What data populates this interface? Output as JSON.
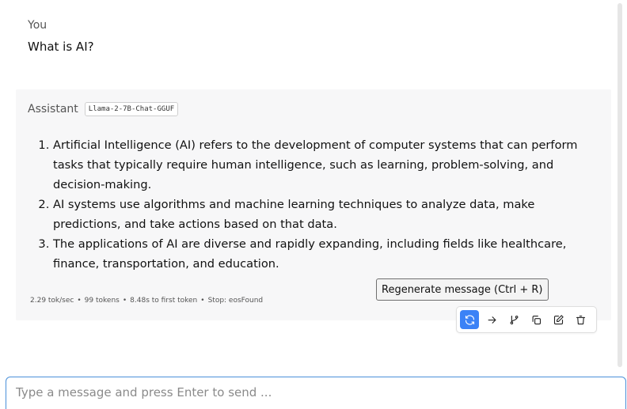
{
  "user_message": {
    "role_label": "You",
    "text": "What is AI?"
  },
  "assistant_message": {
    "role_label": "Assistant",
    "model": "Llama-2-7B-Chat-GGUF",
    "items": [
      "Artificial Intelligence (AI) refers to the development of computer systems that can perform tasks that typically require human intelligence, such as learning, problem-solving, and decision-making.",
      "AI systems use algorithms and machine learning techniques to analyze data, make predictions, and take actions based on that data.",
      "The applications of AI are diverse and rapidly expanding, including fields like healthcare, finance, transportation, and education."
    ],
    "stats": {
      "speed": "2.29 tok/sec",
      "tokens": "99 tokens",
      "first_token": "8.48s to first token",
      "stop": "Stop: eosFound",
      "separator": "•"
    }
  },
  "tooltip": {
    "text": "Regenerate message (Ctrl + R)"
  },
  "actions": [
    {
      "name": "regenerate",
      "icon": "refresh-icon",
      "active": true
    },
    {
      "name": "continue",
      "icon": "arrow-right-icon",
      "active": false
    },
    {
      "name": "branch",
      "icon": "branch-icon",
      "active": false
    },
    {
      "name": "copy",
      "icon": "copy-icon",
      "active": false
    },
    {
      "name": "edit",
      "icon": "edit-icon",
      "active": false
    },
    {
      "name": "delete",
      "icon": "trash-icon",
      "active": false
    }
  ],
  "composer": {
    "placeholder": "Type a message and press Enter to send ...",
    "value": ""
  },
  "colors": {
    "accent": "#3b82f6",
    "card_bg": "#f7f7f8",
    "input_border": "#4a90d9"
  }
}
